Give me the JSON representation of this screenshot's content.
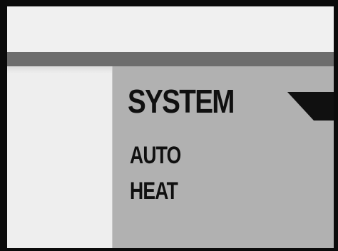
{
  "system": {
    "title": "SYSTEM",
    "options": [
      {
        "label": "AUTO"
      },
      {
        "label": "HEAT"
      }
    ]
  },
  "colors": {
    "frame": "#0b0b0b",
    "light_panel": "#f0f0f0",
    "divider": "#6d6d6d",
    "system_panel": "#b1b1b1",
    "text": "#101010"
  },
  "icons": {
    "pointer": "selection-pointer-icon"
  }
}
